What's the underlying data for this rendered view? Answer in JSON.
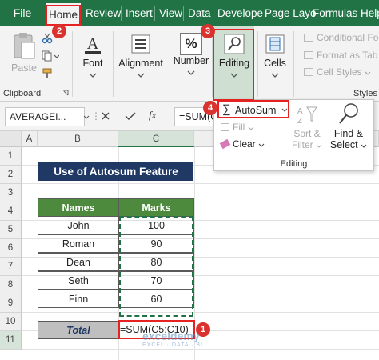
{
  "tabs": [
    "File",
    "Home",
    "Review",
    "Insert",
    "View",
    "Data",
    "Develope",
    "Page Layo",
    "Formulas",
    "Help"
  ],
  "ribbon": {
    "clipboard": {
      "paste": "Paste",
      "label": "Clipboard"
    },
    "font": {
      "label": "Font"
    },
    "alignment": {
      "label": "Alignment"
    },
    "number": {
      "label": "Number",
      "symbol": "%"
    },
    "editing": {
      "label": "Editing"
    },
    "cells": {
      "label": "Cells"
    },
    "styles": {
      "label": "Styles",
      "items": [
        "Conditional Fo",
        "Format as Tab",
        "Cell Styles"
      ]
    }
  },
  "formula_bar": {
    "name_box": "AVERAGEI...",
    "formula": "=SUM(C"
  },
  "dropdown": {
    "autosum": "AutoSum",
    "fill": "Fill",
    "clear": "Clear",
    "sort": [
      "Sort &",
      "Filter"
    ],
    "find": [
      "Find &",
      "Select"
    ],
    "group_label": "Editing",
    "autosum_symbol": "∑"
  },
  "sheet": {
    "columns": [
      "A",
      "B",
      "C"
    ],
    "rows": [
      "1",
      "2",
      "3",
      "4",
      "5",
      "6",
      "7",
      "8",
      "9",
      "10",
      "11"
    ],
    "title": "Use of Autosum Feature",
    "headers": [
      "Names",
      "Marks"
    ],
    "data": [
      {
        "name": "John",
        "mark": "100"
      },
      {
        "name": "Roman",
        "mark": "90"
      },
      {
        "name": "Dean",
        "mark": "80"
      },
      {
        "name": "Seth",
        "mark": "70"
      },
      {
        "name": "Finn",
        "mark": "60"
      }
    ],
    "total_label": "Total",
    "total_formula": "=SUM(C5:C10)"
  },
  "badges": [
    "1",
    "2",
    "3",
    "4"
  ],
  "watermark": {
    "brand": "exceldemy",
    "tagline": "EXCEL · DATA · BI"
  },
  "colors": {
    "excel_green": "#217346",
    "title_bg": "#1f3864",
    "header_bg": "#4e8a3e",
    "highlight": "#e52323"
  }
}
